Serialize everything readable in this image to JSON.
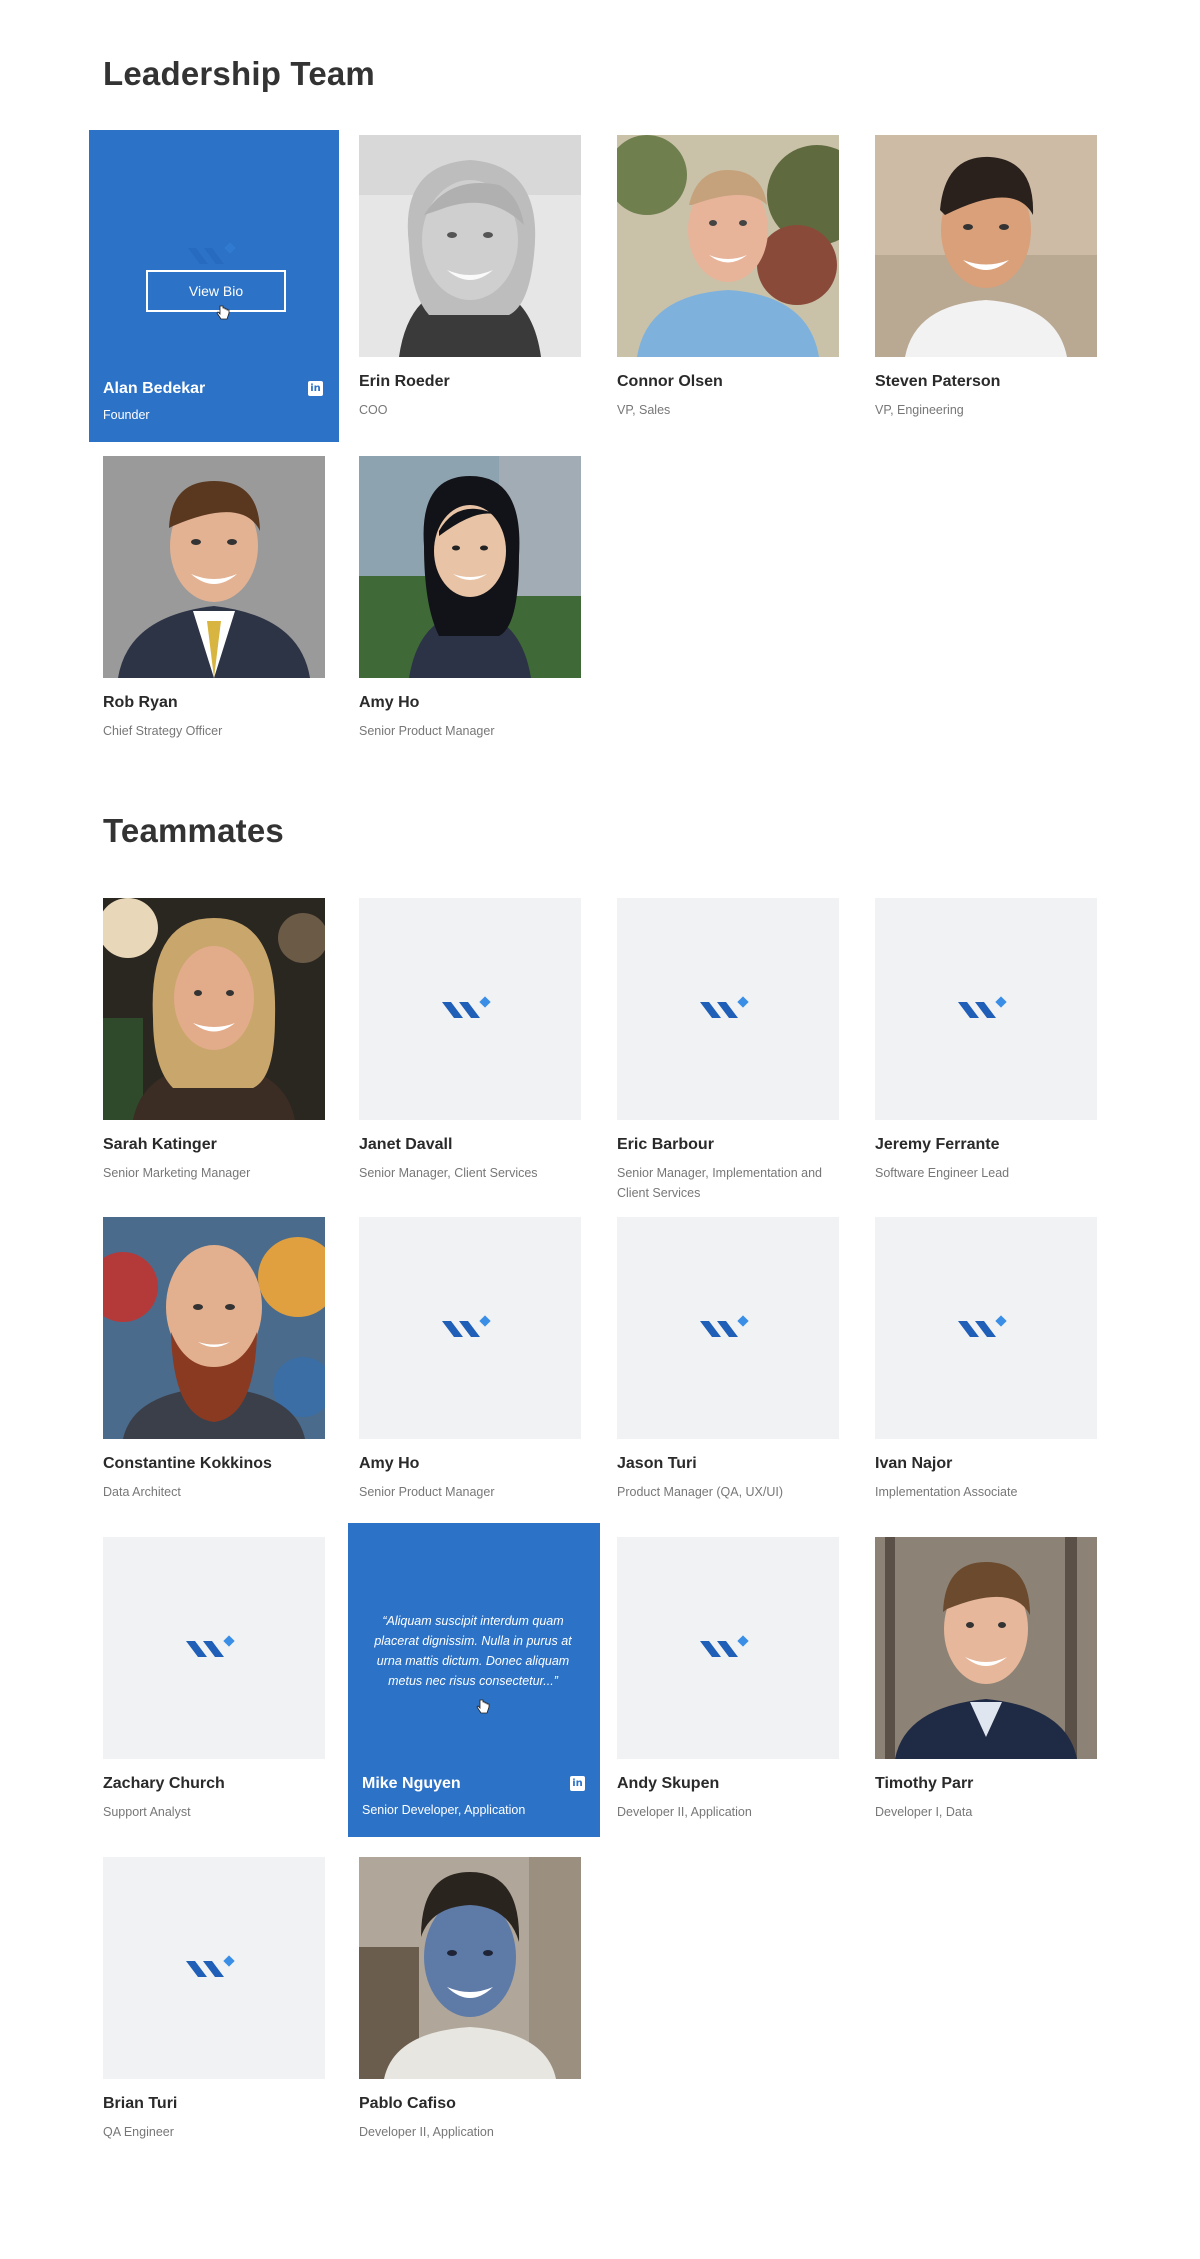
{
  "sections": {
    "leadership_title": "Leadership Team",
    "teammates_title": "Teammates"
  },
  "leadership": [
    {
      "name": "Alan Bedekar",
      "role": "Founder",
      "photo": "logo-hover",
      "hover_button": "View Bio"
    },
    {
      "name": "Erin Roeder",
      "role": "COO",
      "photo": "portrait"
    },
    {
      "name": "Connor Olsen",
      "role": "VP, Sales",
      "photo": "portrait"
    },
    {
      "name": "Steven Paterson",
      "role": "VP, Engineering",
      "photo": "portrait"
    },
    {
      "name": "Rob Ryan",
      "role": "Chief Strategy Officer",
      "photo": "portrait"
    },
    {
      "name": "Amy Ho",
      "role": "Senior Product Manager",
      "photo": "portrait"
    }
  ],
  "teammates": [
    {
      "name": "Sarah Katinger",
      "role": "Senior Marketing Manager",
      "photo": "portrait"
    },
    {
      "name": "Janet Davall",
      "role": "Senior Manager, Client Services",
      "photo": "placeholder"
    },
    {
      "name": "Eric Barbour",
      "role": "Senior Manager, Implementation and Client Services",
      "photo": "placeholder"
    },
    {
      "name": "Jeremy Ferrante",
      "role": "Software Engineer Lead",
      "photo": "placeholder"
    },
    {
      "name": "Constantine Kokkinos",
      "role": "Data Architect",
      "photo": "portrait"
    },
    {
      "name": "Amy Ho",
      "role": "Senior Product Manager",
      "photo": "placeholder"
    },
    {
      "name": "Jason Turi",
      "role": "Product Manager (QA, UX/UI)",
      "photo": "placeholder"
    },
    {
      "name": "Ivan Najor",
      "role": "Implementation Associate",
      "photo": "placeholder"
    },
    {
      "name": "Zachary Church",
      "role": "Support Analyst",
      "photo": "placeholder"
    },
    {
      "name": "Mike Nguyen",
      "role": "Senior Developer, Application",
      "photo": "quote-hover",
      "quote": "“Aliquam suscipit interdum quam placerat dignissim. Nulla in purus at urna mattis dictum. Donec aliquam metus nec risus consectetur...”"
    },
    {
      "name": "Andy Skupen",
      "role": "Developer II, Application",
      "photo": "placeholder"
    },
    {
      "name": "Timothy Parr",
      "role": "Developer I, Data",
      "photo": "portrait"
    },
    {
      "name": "Brian Turi",
      "role": "QA Engineer",
      "photo": "placeholder"
    },
    {
      "name": "Pablo Cafiso",
      "role": "Developer II, Application",
      "photo": "portrait"
    }
  ],
  "icons": {
    "linkedin": "linkedin-icon",
    "logo": "company-logo-icon",
    "cursor": "hand-cursor-icon"
  },
  "colors": {
    "accent": "#2c72c7",
    "logo_dark": "#1f5fb8",
    "logo_light": "#3a8ee6",
    "placeholder_bg": "#f1f2f4"
  }
}
